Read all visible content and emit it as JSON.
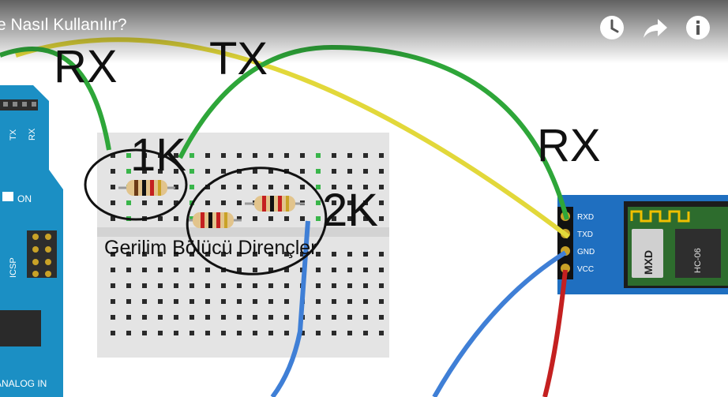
{
  "video": {
    "title": "e Nasıl Kullanılır?"
  },
  "controls": [
    {
      "name": "watch-later-icon"
    },
    {
      "name": "share-icon"
    },
    {
      "name": "info-icon"
    }
  ],
  "annotations": {
    "rx_left": "RX",
    "tx": "TX",
    "rx_right": "RX",
    "r1": "1K",
    "r2": "2K",
    "caption": "Gerilim Bölücü Dirençler"
  },
  "arduino": {
    "tx_label": "TX",
    "rx_label": "RX",
    "on_label": "ON",
    "icsp_label": "ICSP",
    "analog_label": "ANALOG IN"
  },
  "module": {
    "pins": [
      "RXD",
      "TXD",
      "GND",
      "VCC"
    ],
    "chip_label": "MXD",
    "model_label": "HC-06"
  },
  "colors": {
    "arduino_blue": "#1b8fc4",
    "module_blue": "#1f6fc0",
    "wire_green": "#2ea639",
    "wire_yellow": "#e2d83a",
    "wire_blue": "#3f7fd6",
    "wire_red": "#c42020",
    "breadboard": "#e4e4e4"
  }
}
